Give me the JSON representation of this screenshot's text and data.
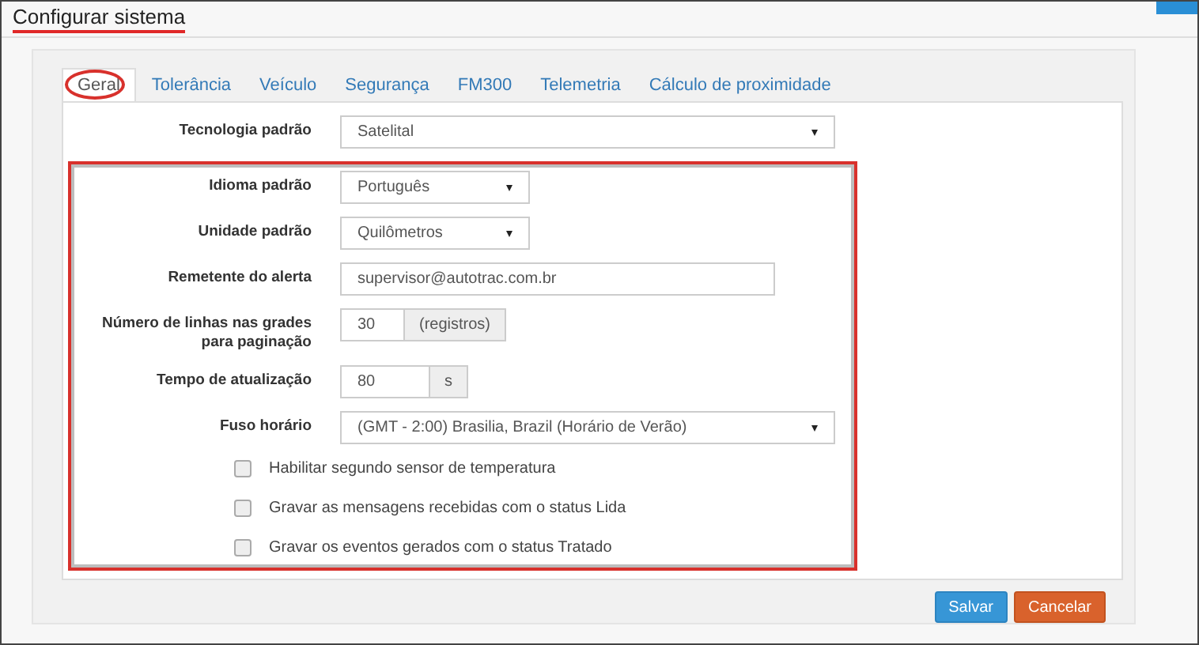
{
  "window": {
    "title": "Configurar sistema",
    "title_underlined": true
  },
  "tabs": [
    {
      "label": "Geral",
      "selected": true,
      "circled": true
    },
    {
      "label": "Tolerância",
      "selected": false,
      "circled": false
    },
    {
      "label": "Veículo",
      "selected": false,
      "circled": false
    },
    {
      "label": "Segurança",
      "selected": false,
      "circled": false
    },
    {
      "label": "FM300",
      "selected": false,
      "circled": false
    },
    {
      "label": "Telemetria",
      "selected": false,
      "circled": false
    },
    {
      "label": "Cálculo de proximidade",
      "selected": false,
      "circled": false
    }
  ],
  "sections": [
    {
      "highlighted": false,
      "rows": [
        {
          "kind": "select",
          "label": "Tecnologia padrão",
          "value": "Satelital"
        }
      ]
    },
    {
      "highlighted": true,
      "rows": [
        {
          "kind": "select",
          "label": "Idioma padrão",
          "value": "Português"
        },
        {
          "kind": "select",
          "label": "Unidade padrão",
          "value": "Quilômetros"
        },
        {
          "kind": "text",
          "label": "Remetente do alerta",
          "value": "supervisor@autotrac.com.br"
        },
        {
          "kind": "addon",
          "label": "Número de linhas nas grades para paginação",
          "value": "30",
          "addon": "(registros)"
        },
        {
          "kind": "addon",
          "label": "Tempo de atualização",
          "value": "80",
          "addon": "s"
        },
        {
          "kind": "select",
          "label": "Fuso horário",
          "value": "(GMT - 2:00) Brasilia, Brazil (Horário de Verão)"
        },
        {
          "kind": "checkbox",
          "label": "Habilitar segundo sensor de temperatura",
          "checked": false
        },
        {
          "kind": "checkbox",
          "label": "Gravar as mensagens recebidas com o status Lida",
          "checked": false
        },
        {
          "kind": "checkbox",
          "label": "Gravar os eventos gerados com o status Tratado",
          "checked": false
        }
      ]
    }
  ],
  "buttons": [
    {
      "label": "Salvar",
      "kind": "primary"
    },
    {
      "label": "Cancelar",
      "kind": "danger"
    }
  ]
}
